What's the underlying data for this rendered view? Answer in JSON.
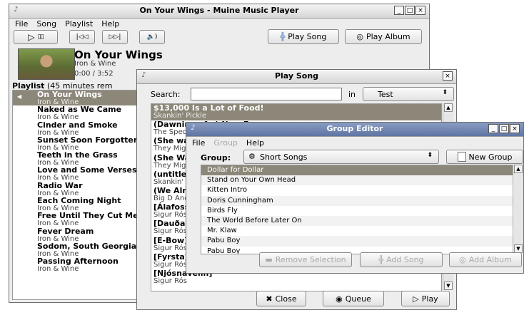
{
  "main": {
    "title": "On Your Wings - Muine Music Player",
    "menus": [
      "File",
      "Song",
      "Playlist",
      "Help"
    ],
    "transport": {
      "prev_icon": "|◁◁",
      "next_icon": "▷▷|",
      "volume_icon": "🔈)"
    },
    "play_song_label": "Play Song",
    "play_album_label": "Play Album",
    "now_playing": {
      "title": "On Your Wings",
      "artist": "Iron & Wine",
      "time": "0:00 / 3:52"
    },
    "playlist_label": "Playlist",
    "playlist_length": "(45 minutes rem",
    "playlist": [
      {
        "title": "On Your Wings",
        "artist": "Iron & Wine"
      },
      {
        "title": "Naked as We Came",
        "artist": "Iron & Wine"
      },
      {
        "title": "Cinder and Smoke",
        "artist": "Iron & Wine"
      },
      {
        "title": "Sunset Soon Forgotten",
        "artist": "Iron & Wine"
      },
      {
        "title": "Teeth in the Grass",
        "artist": "Iron & Wine"
      },
      {
        "title": "Love and Some Verses",
        "artist": "Iron & Wine"
      },
      {
        "title": "Radio War",
        "artist": "Iron & Wine"
      },
      {
        "title": "Each Coming Night",
        "artist": "Iron & Wine"
      },
      {
        "title": "Free Until They Cut Me Down",
        "artist": "Iron & Wine"
      },
      {
        "title": "Fever Dream",
        "artist": "Iron & Wine"
      },
      {
        "title": "Sodom, South Georgia",
        "artist": "Iron & Wine"
      },
      {
        "title": "Passing Afternoon",
        "artist": "Iron & Wine"
      }
    ]
  },
  "play": {
    "title": "Play Song",
    "search_label": "Search:",
    "search_value": "",
    "in_label": "in",
    "in_value": "Test",
    "songs": [
      {
        "title": "$13,000 Is a Lot of Food!",
        "artist": "Skankin' Pickle"
      },
      {
        "title": "(Dawning of a) New Era",
        "artist": "The Specials"
      },
      {
        "title": "(She was a) Hotel Detective",
        "artist": "They Might Be Giants"
      },
      {
        "title": "(She Was a) Hotel Detective",
        "artist": "They Might Be Giants"
      },
      {
        "title": "(untitled)",
        "artist": "Skankin' Pickle"
      },
      {
        "title": "(We Almost Had A) Riot",
        "artist": "Big D And The Kids Table"
      },
      {
        "title": "[Álafoss]",
        "artist": "Sigur Rós"
      },
      {
        "title": "[Dauðalagið]",
        "artist": "Sigur Rós"
      },
      {
        "title": "[E-Bow]",
        "artist": "Sigur Rós"
      },
      {
        "title": "[Fyrsta]",
        "artist": "Sigur Rós"
      },
      {
        "title": "[Njósnavélin]",
        "artist": "Sigur Rós"
      }
    ],
    "close_label": "Close",
    "queue_label": "Queue",
    "play_label": "Play"
  },
  "group": {
    "title": "Group Editor",
    "menus": [
      "File",
      "Group",
      "Help"
    ],
    "group_label": "Group:",
    "group_value": "Short Songs",
    "new_group_label": "New Group",
    "items": [
      "Dollar for Dollar",
      "Stand on Your Own Head",
      "Kitten Intro",
      "Doris Cunningham",
      "Birds Fly",
      "The World Before Later On",
      "Mr. Klaw",
      "Pabu Boy",
      "Pabu Boy"
    ],
    "remove_label": "Remove Selection",
    "add_song_label": "Add Song",
    "add_album_label": "Add Album"
  },
  "colors": {
    "selection": "#8c8779",
    "window_bg": "#ededed"
  }
}
